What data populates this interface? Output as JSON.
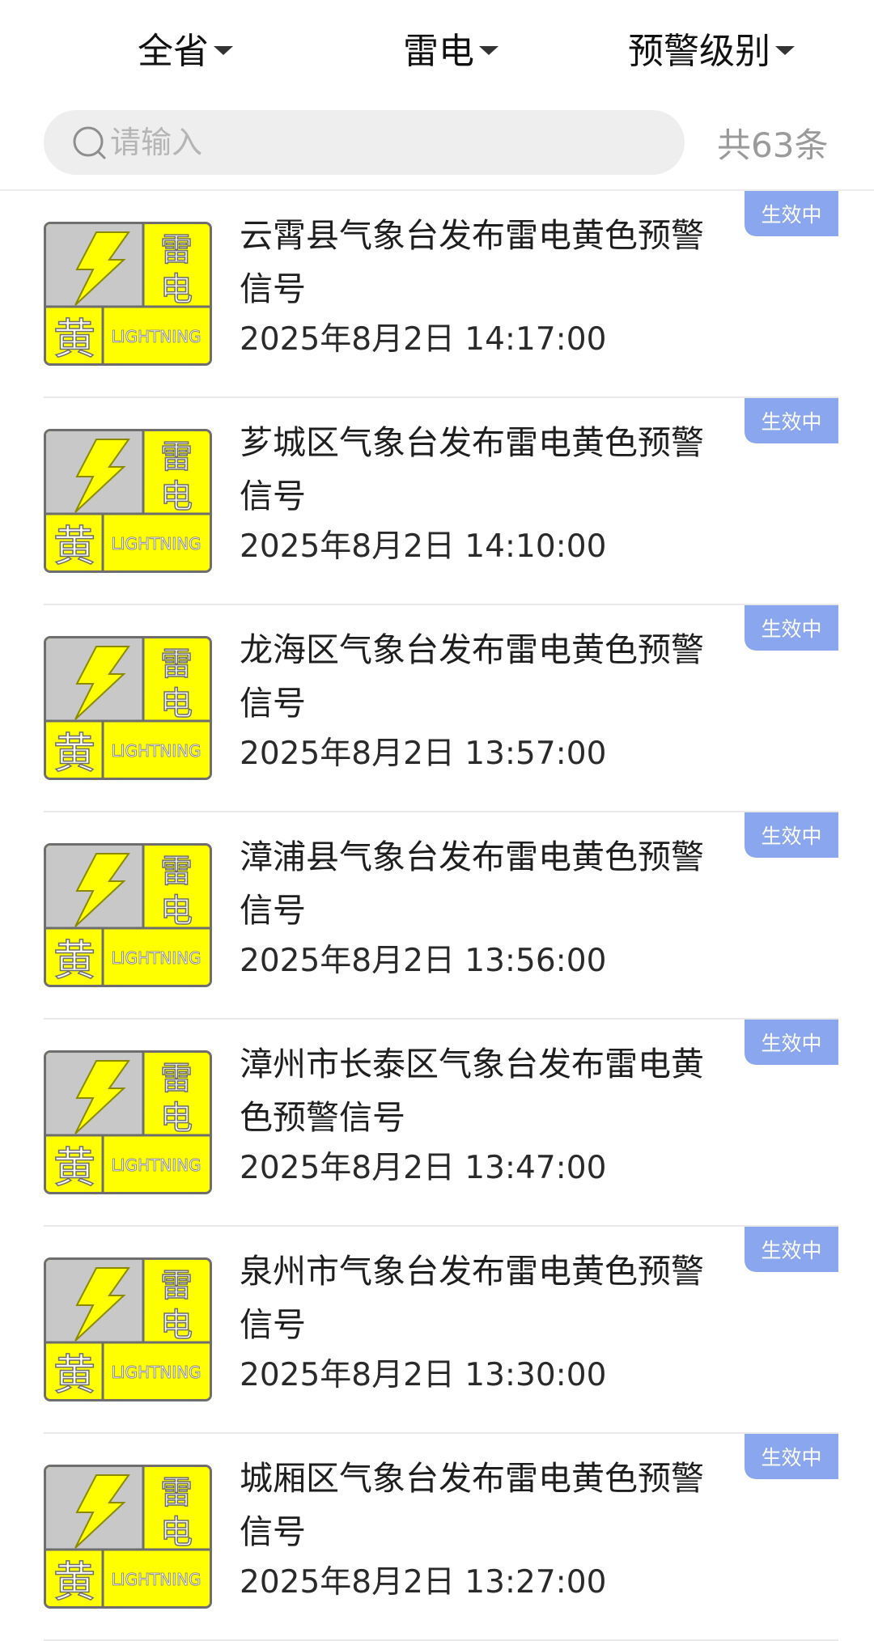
{
  "filters": {
    "region": "全省",
    "type": "雷电",
    "level": "预警级别"
  },
  "search": {
    "placeholder": "请输入",
    "count_label": "共63条"
  },
  "badge": {
    "char_top1": "雷",
    "char_top2": "电",
    "level_char": "黄",
    "english": "LIGHTNING",
    "colors": {
      "fill": "#ffff00",
      "gray": "#c8c8c8",
      "border": "#6e6e6e"
    },
    "icon": "lightning-bolt-icon"
  },
  "status_color": "#89a6ee",
  "items": [
    {
      "title_line1": "云霄县气象台发布雷电黄色预警",
      "title_line2": "信号",
      "time": "2025年8月2日 14:17:00",
      "status": "生效中"
    },
    {
      "title_line1": "芗城区气象台发布雷电黄色预警",
      "title_line2": "信号",
      "time": "2025年8月2日 14:10:00",
      "status": "生效中"
    },
    {
      "title_line1": "龙海区气象台发布雷电黄色预警",
      "title_line2": "信号",
      "time": "2025年8月2日 13:57:00",
      "status": "生效中"
    },
    {
      "title_line1": "漳浦县气象台发布雷电黄色预警",
      "title_line2": "信号",
      "time": "2025年8月2日 13:56:00",
      "status": "生效中"
    },
    {
      "title_line1": "漳州市长泰区气象台发布雷电黄",
      "title_line2": "色预警信号",
      "time": "2025年8月2日 13:47:00",
      "status": "生效中"
    },
    {
      "title_line1": "泉州市气象台发布雷电黄色预警",
      "title_line2": "信号",
      "time": "2025年8月2日 13:30:00",
      "status": "生效中"
    },
    {
      "title_line1": "城厢区气象台发布雷电黄色预警",
      "title_line2": "信号",
      "time": "2025年8月2日 13:27:00",
      "status": "生效中"
    }
  ]
}
